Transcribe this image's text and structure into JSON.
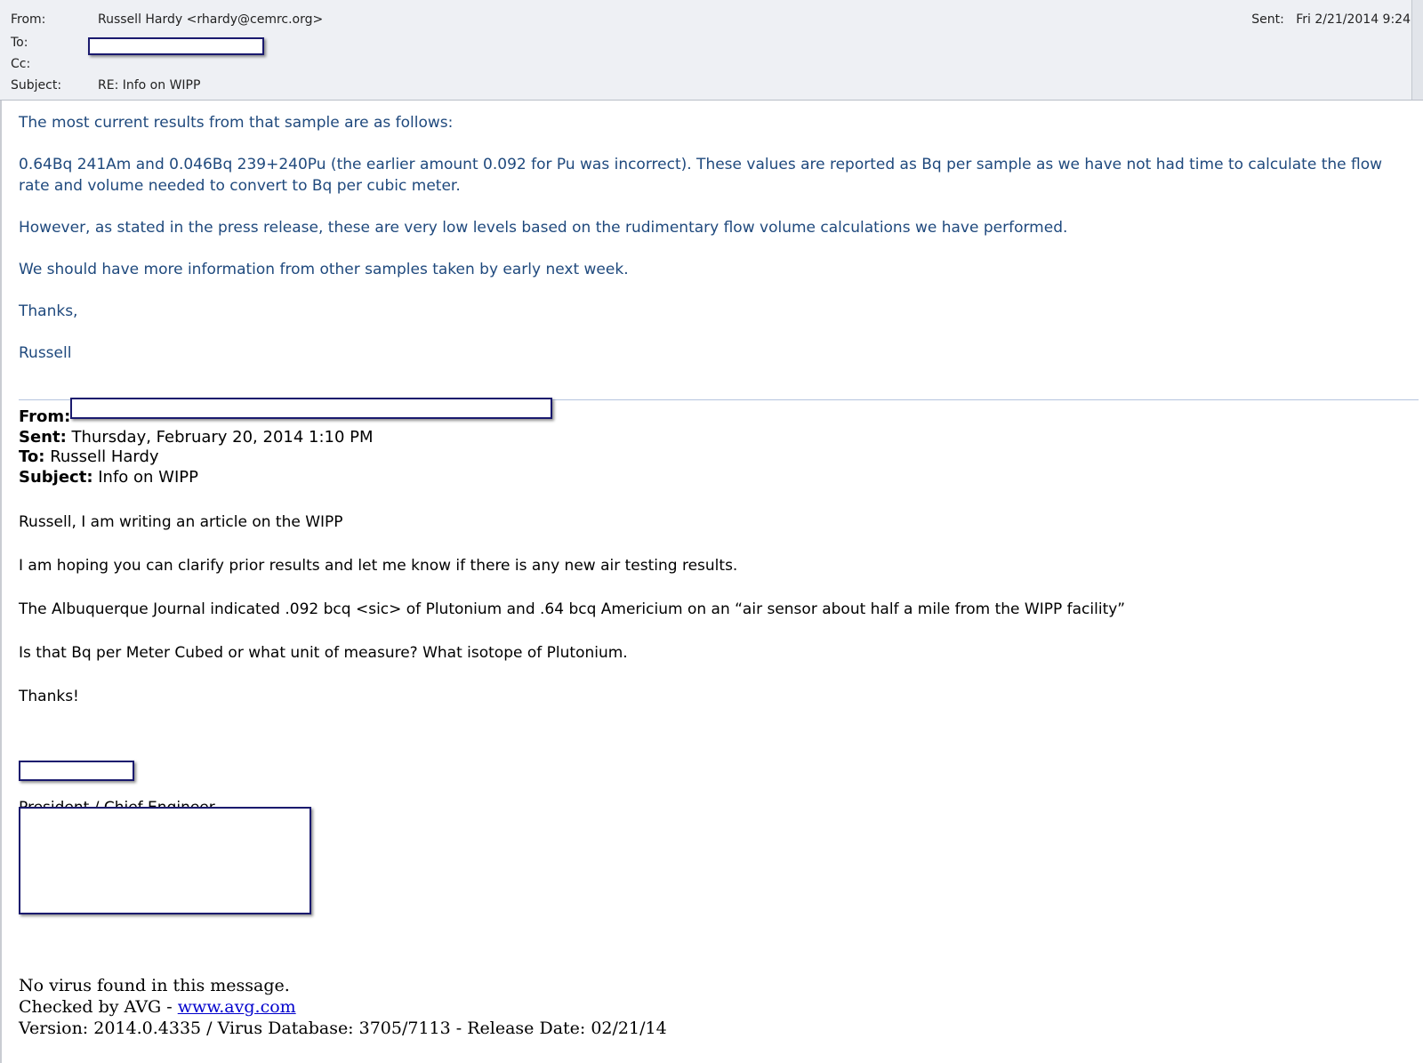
{
  "header": {
    "from_label": "From:",
    "from_value": "Russell Hardy <rhardy@cemrc.org>",
    "to_label": "To:",
    "cc_label": "Cc:",
    "subject_label": "Subject:",
    "subject_value": "RE: Info on WIPP",
    "sent_label": "Sent:",
    "sent_value": "Fri 2/21/2014 9:24"
  },
  "reply": {
    "p1": "The most current results from that sample are as follows:",
    "p2": "0.64Bq 241Am and 0.046Bq 239+240Pu (the earlier amount 0.092 for Pu was incorrect).  These values are reported as Bq per sample as we have not had time to calculate the flow rate and volume needed to convert to Bq per cubic meter.",
    "p3": "However, as stated in the press release, these are very low levels based on the rudimentary flow volume calculations we have performed.",
    "p4": "We should have more information from other samples taken by early next week.",
    "p5": "Thanks,",
    "p6": "Russell"
  },
  "original": {
    "from_label": "From:",
    "sent_label": "Sent:",
    "sent_value": "Thursday, February 20, 2014 1:10 PM",
    "to_label": "To:",
    "to_value": "Russell Hardy",
    "subject_label": "Subject:",
    "subject_value": "Info on WIPP",
    "p1": "Russell, I am writing an article on the WIPP",
    "p2": "I am hoping you can clarify prior results and let me know if there is any new air testing results.",
    "p3": "The Albuquerque Journal indicated .092 bcq <sic> of Plutonium and .64 bcq Americium on an “air sensor about half a mile from the WIPP facility”",
    "p4": "Is that Bq per Meter Cubed or what unit of measure?    What isotope of Plutonium.",
    "p5": "Thanks!",
    "sig_title": "President / Chief Engineer"
  },
  "avg": {
    "line1": "No virus found in this message.",
    "line2_prefix": "Checked by AVG - ",
    "line2_link": "www.avg.com",
    "line3": "Version: 2014.0.4335 / Virus Database: 3705/7113 - Release Date: 02/21/14"
  }
}
